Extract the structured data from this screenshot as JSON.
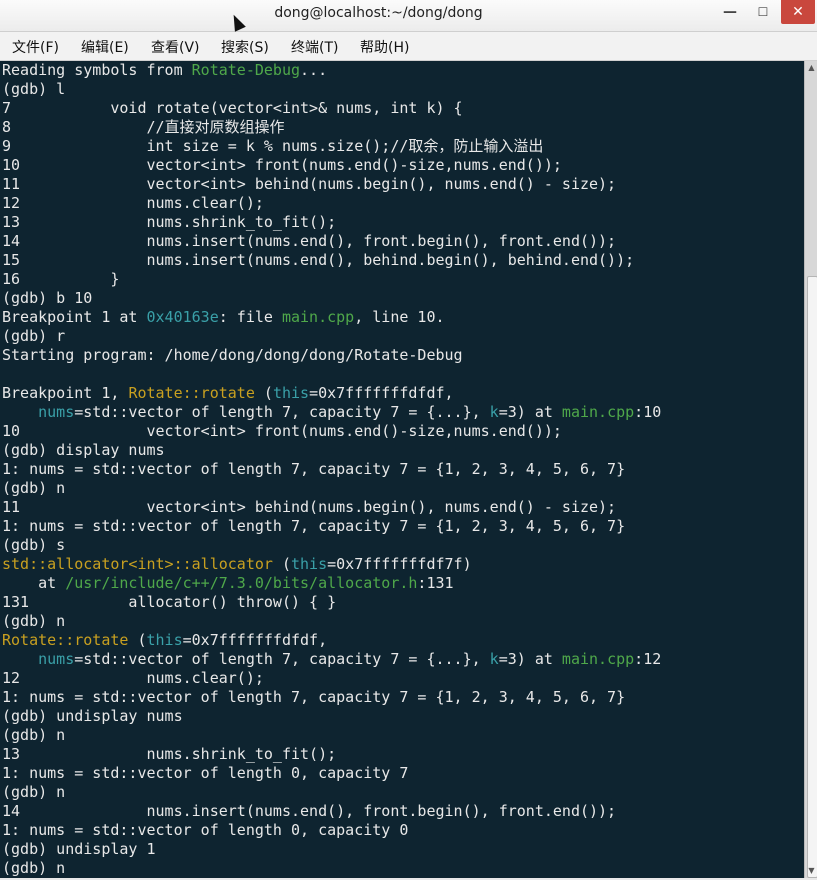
{
  "window": {
    "title": "dong@localhost:~/dong/dong",
    "minimize_label": "—",
    "maximize_label": "☐",
    "close_label": "✕"
  },
  "menu": [
    "文件(F)",
    "编辑(E)",
    "查看(V)",
    "搜索(S)",
    "终端(T)",
    "帮助(H)"
  ],
  "colors": {
    "background": "#0e2430",
    "text": "#e8e8e8",
    "green": "#4fa84a",
    "teal": "#3aa0a8",
    "yellow": "#c8a020"
  },
  "icons": {
    "minimize": "minimize-icon",
    "maximize": "maximize-icon",
    "close": "close-icon",
    "scroll_up": "scroll-up-arrow-icon",
    "scroll_down": "scroll-down-arrow-icon",
    "mouse_pointer": "mouse-pointer-icon"
  },
  "terminal_lines": [
    [
      {
        "t": "Reading symbols from "
      },
      {
        "t": "Rotate-Debug",
        "c": "g"
      },
      {
        "t": "..."
      }
    ],
    [
      {
        "t": "(gdb) l"
      }
    ],
    [
      {
        "t": "7           void rotate(vector<int>& nums, int k) {"
      }
    ],
    [
      {
        "t": "8               //直接对原数组操作"
      }
    ],
    [
      {
        "t": "9               int size = k % nums.size();//取余，防止输入溢出"
      }
    ],
    [
      {
        "t": "10              vector<int> front(nums.end()-size,nums.end());"
      }
    ],
    [
      {
        "t": "11              vector<int> behind(nums.begin(), nums.end() - size);"
      }
    ],
    [
      {
        "t": "12              nums.clear();"
      }
    ],
    [
      {
        "t": "13              nums.shrink_to_fit();"
      }
    ],
    [
      {
        "t": "14              nums.insert(nums.end(), front.begin(), front.end());"
      }
    ],
    [
      {
        "t": "15              nums.insert(nums.end(), behind.begin(), behind.end());"
      }
    ],
    [
      {
        "t": "16          }"
      }
    ],
    [
      {
        "t": "(gdb) b 10"
      }
    ],
    [
      {
        "t": "Breakpoint 1 at "
      },
      {
        "t": "0x40163e",
        "c": "b"
      },
      {
        "t": ": file "
      },
      {
        "t": "main.cpp",
        "c": "g"
      },
      {
        "t": ", line 10."
      }
    ],
    [
      {
        "t": "(gdb) r"
      }
    ],
    [
      {
        "t": "Starting program: /home/dong/dong/dong/Rotate-Debug"
      }
    ],
    [
      {
        "t": ""
      }
    ],
    [
      {
        "t": "Breakpoint 1, "
      },
      {
        "t": "Rotate::rotate",
        "c": "y"
      },
      {
        "t": " ("
      },
      {
        "t": "this",
        "c": "b"
      },
      {
        "t": "=0x7fffffffdfdf,"
      }
    ],
    [
      {
        "t": "    "
      },
      {
        "t": "nums",
        "c": "b"
      },
      {
        "t": "=std::vector of length 7, capacity 7 = {...}, "
      },
      {
        "t": "k",
        "c": "b"
      },
      {
        "t": "=3) at "
      },
      {
        "t": "main.cpp",
        "c": "g"
      },
      {
        "t": ":10"
      }
    ],
    [
      {
        "t": "10              vector<int> front(nums.end()-size,nums.end());"
      }
    ],
    [
      {
        "t": "(gdb) display nums"
      }
    ],
    [
      {
        "t": "1: nums = std::vector of length 7, capacity 7 = {1, 2, 3, 4, 5, 6, 7}"
      }
    ],
    [
      {
        "t": "(gdb) n"
      }
    ],
    [
      {
        "t": "11              vector<int> behind(nums.begin(), nums.end() - size);"
      }
    ],
    [
      {
        "t": "1: nums = std::vector of length 7, capacity 7 = {1, 2, 3, 4, 5, 6, 7}"
      }
    ],
    [
      {
        "t": "(gdb) s"
      }
    ],
    [
      {
        "t": "std::allocator<int>::allocator",
        "c": "y"
      },
      {
        "t": " ("
      },
      {
        "t": "this",
        "c": "b"
      },
      {
        "t": "=0x7fffffffdf7f)"
      }
    ],
    [
      {
        "t": "    at "
      },
      {
        "t": "/usr/include/c++/7.3.0/bits/allocator.h",
        "c": "g"
      },
      {
        "t": ":131"
      }
    ],
    [
      {
        "t": "131           allocator() throw() { }"
      }
    ],
    [
      {
        "t": "(gdb) n"
      }
    ],
    [
      {
        "t": "Rotate::rotate",
        "c": "y"
      },
      {
        "t": " ("
      },
      {
        "t": "this",
        "c": "b"
      },
      {
        "t": "=0x7fffffffdfdf,"
      }
    ],
    [
      {
        "t": "    "
      },
      {
        "t": "nums",
        "c": "b"
      },
      {
        "t": "=std::vector of length 7, capacity 7 = {...}, "
      },
      {
        "t": "k",
        "c": "b"
      },
      {
        "t": "=3) at "
      },
      {
        "t": "main.cpp",
        "c": "g"
      },
      {
        "t": ":12"
      }
    ],
    [
      {
        "t": "12              nums.clear();"
      }
    ],
    [
      {
        "t": "1: nums = std::vector of length 7, capacity 7 = {1, 2, 3, 4, 5, 6, 7}"
      }
    ],
    [
      {
        "t": "(gdb) undisplay nums"
      }
    ],
    [
      {
        "t": "(gdb) n"
      }
    ],
    [
      {
        "t": "13              nums.shrink_to_fit();"
      }
    ],
    [
      {
        "t": "1: nums = std::vector of length 0, capacity 7"
      }
    ],
    [
      {
        "t": "(gdb) n"
      }
    ],
    [
      {
        "t": "14              nums.insert(nums.end(), front.begin(), front.end());"
      }
    ],
    [
      {
        "t": "1: nums = std::vector of length 0, capacity 0"
      }
    ],
    [
      {
        "t": "(gdb) undisplay 1"
      }
    ],
    [
      {
        "t": "(gdb) n"
      }
    ]
  ]
}
